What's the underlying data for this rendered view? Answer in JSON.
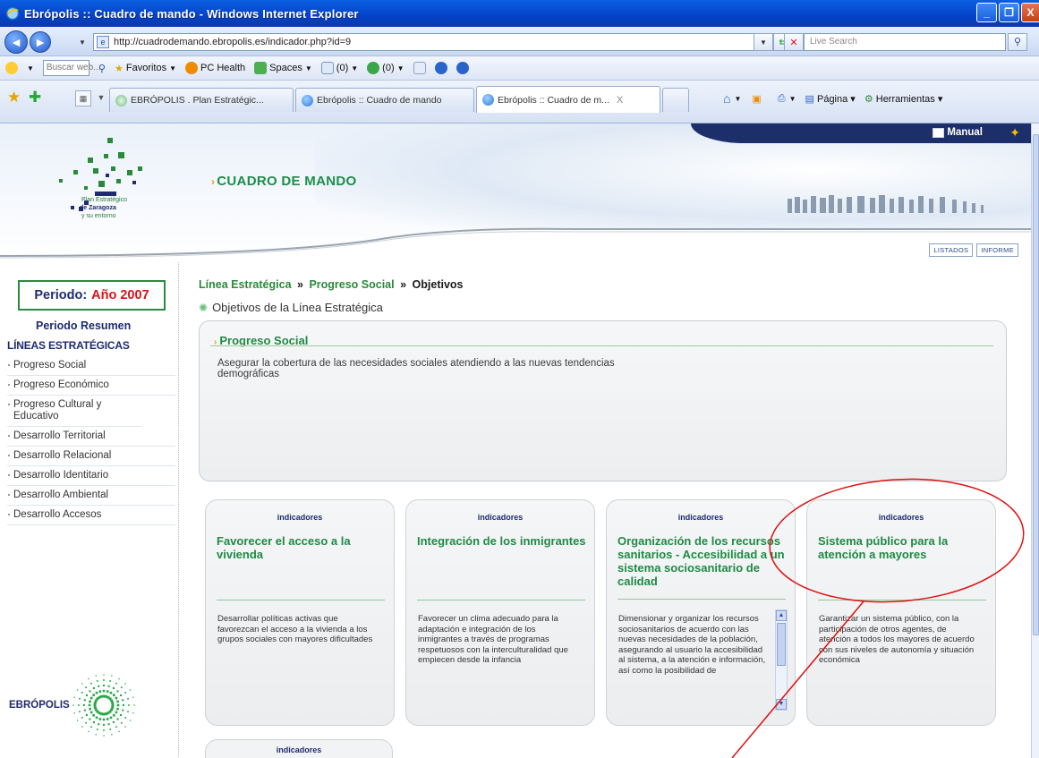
{
  "window": {
    "title": "Ebrópolis :: Cuadro de mando - Windows Internet Explorer",
    "buttons": [
      "_",
      "❐",
      "X"
    ]
  },
  "addressbar": {
    "url": "http://cuadrodemando.ebropolis.es/indicador.php?id=9",
    "search_placeholder": "Live Search"
  },
  "linksbar": {
    "search_placeholder": "Buscar web...",
    "items": [
      "Favoritos",
      "PC Health",
      "Spaces",
      "(0)",
      "(0)"
    ]
  },
  "tabs": {
    "items": [
      {
        "label": "EBRÓPOLIS . Plan Estratégic..."
      },
      {
        "label": "Ebrópolis :: Cuadro de mando"
      },
      {
        "label": "Ebrópolis :: Cuadro de m..."
      }
    ],
    "close": "X",
    "commands": [
      "Página",
      "Herramientas"
    ]
  },
  "header": {
    "manual": "Manual",
    "title": "CUADRO DE MANDO",
    "logo_text": [
      "Plan Estratégico",
      "de Zaragoza",
      "y su entorno"
    ],
    "buttons": [
      "LISTADOS",
      "INFORME"
    ]
  },
  "sidebar": {
    "periodo_label": "Periodo:",
    "periodo_value": "Año 2007",
    "resumen": "Periodo Resumen",
    "heading": "LÍNEAS ESTRATÉGICAS",
    "items": [
      "Progreso Social",
      "Progreso Económico",
      "Progreso Cultural y Educativo",
      "Desarrollo Territorial",
      "Desarrollo Relacional",
      "Desarrollo Identitario",
      "Desarrollo Ambiental",
      "Desarrollo Accesos"
    ],
    "brand": "EBRÓPOLIS"
  },
  "breadcrumb": {
    "a": "Línea Estratégica",
    "b": "Progreso Social",
    "c": "Objetivos",
    "sep": "»"
  },
  "section_title": "Objetivos de la Línea Estratégica",
  "objective": {
    "title": "Progreso Social",
    "description": "Asegurar la cobertura de las necesidades sociales atendiendo a las nuevas tendencias demográficas"
  },
  "cards": [
    {
      "label": "indicadores",
      "title": "Favorecer el acceso a la vivienda",
      "description": "Desarrollar políticas activas que favorezcan el acceso a la vivienda a los grupos sociales con mayores dificultades"
    },
    {
      "label": "indicadores",
      "title": "Integración de los inmigrantes",
      "description": "Favorecer un clima adecuado para la adaptación e integración de los inmigrantes a través de programas respetuosos con la interculturalidad que empiecen desde la infancia"
    },
    {
      "label": "indicadores",
      "title": "Organización de los recursos sanitarios - Accesibilidad a un sistema sociosanitario de calidad",
      "description": "Dimensionar y organizar los recursos sociosanitarios de acuerdo con las nuevas necesidades de la población, asegurando al usuario la accesibilidad al sistema, a la atención e información, así como la posibilidad de"
    },
    {
      "label": "indicadores",
      "title": "Sistema público para la atención a mayores",
      "description": "Garantizar un sistema público, con la participación de otros agentes, de atención a todos los mayores de acuerdo con sus niveles de autonomía y situación económica"
    }
  ],
  "card5_label": "indicadores",
  "colors": {
    "green": "#1f8a44",
    "navy": "#1e2b70",
    "red_year": "#d8121a",
    "annotation": "#e01010"
  }
}
